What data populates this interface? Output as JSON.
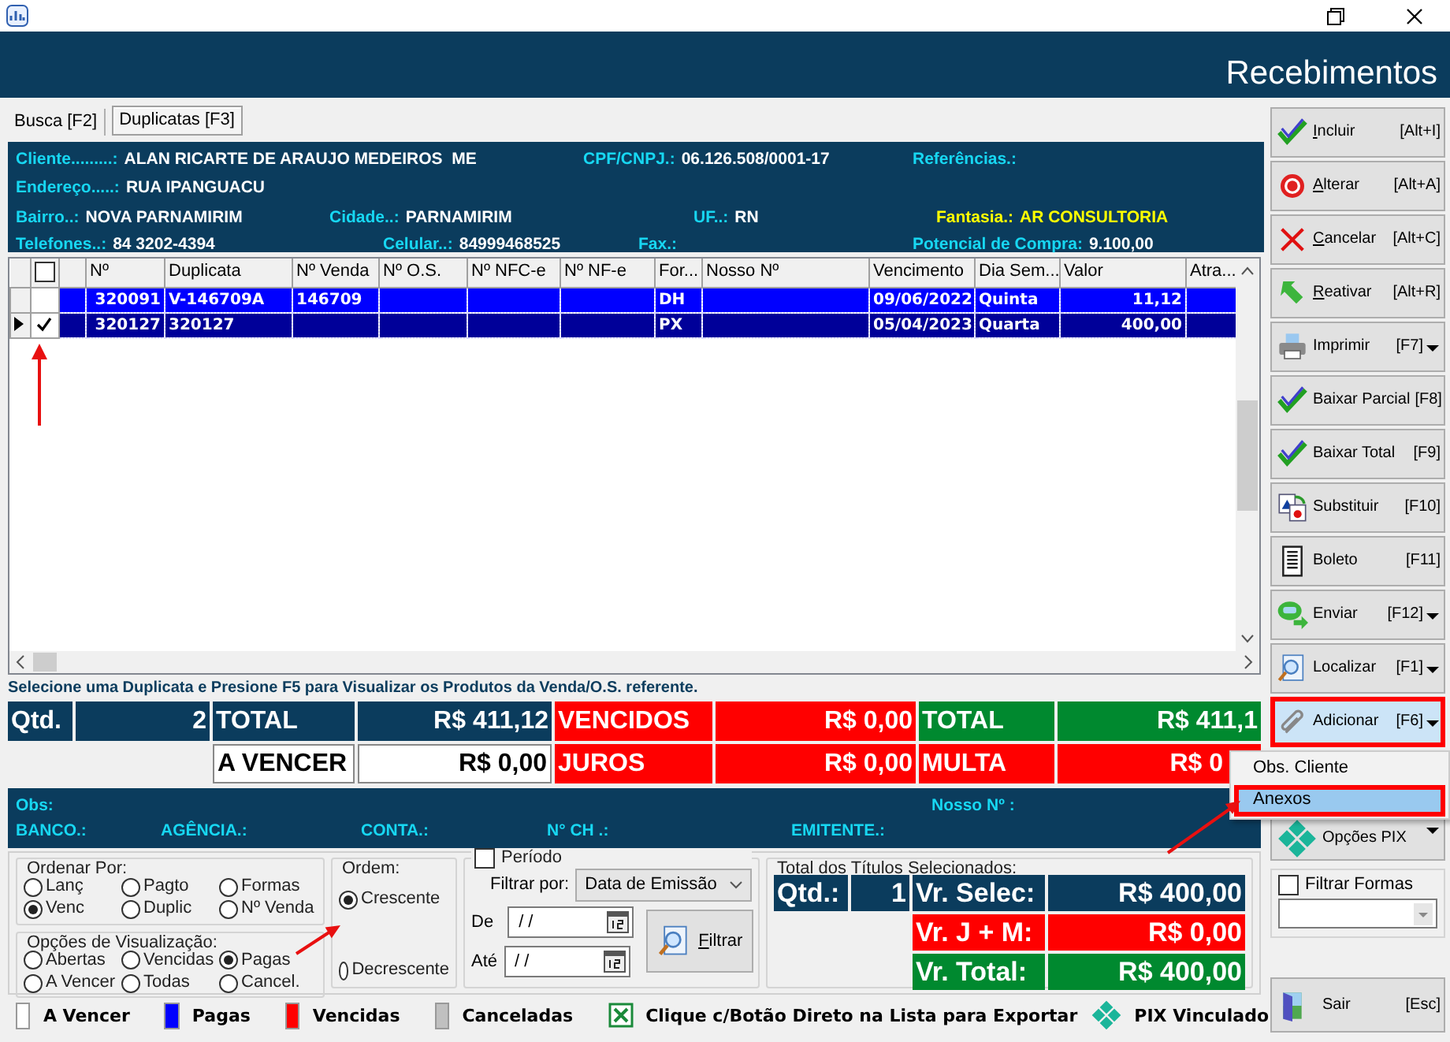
{
  "header": {
    "title": "Recebimentos"
  },
  "tabs": [
    {
      "label": "Busca [F2]",
      "selected": false
    },
    {
      "label": "Duplicatas [F3]",
      "selected": true
    }
  ],
  "client_info": [
    [
      {
        "label": "Cliente.........:",
        "value": "ALAN RICARTE DE ARAUJO MEDEIROS  ME",
        "highlight": false
      },
      {
        "label": "CPF/CNPJ.:",
        "value": "06.126.508/0001-17",
        "highlight": false
      },
      {
        "label": "Referências.:",
        "highlight": false
      }
    ],
    [
      {
        "label": "Endereço.....:",
        "value": "RUA IPANGUACU",
        "highlight": false
      }
    ],
    [
      {
        "label": "Bairro..:",
        "value": "NOVA PARNAMIRIM",
        "highlight": false
      },
      {
        "label": "Cidade..:",
        "value": "PARNAMIRIM",
        "highlight": false
      },
      {
        "label": "UF..:",
        "value": "RN",
        "highlight": false
      },
      {
        "label": "Fantasia.:",
        "value": "AR CONSULTORIA",
        "highlight": true
      }
    ],
    [
      {
        "label": "Telefones..:",
        "value": "84 3202-4394",
        "highlight": false
      },
      {
        "label": "Celular..:",
        "value": "84999468525",
        "highlight": false
      },
      {
        "label": "Fax.:",
        "highlight": false
      },
      {
        "label": "Potencial de Compra:",
        "value": "9.100,00",
        "highlight": false
      }
    ]
  ],
  "grid": {
    "select_all_checked": false,
    "columns": [
      null,
      "Nº",
      "Duplicata",
      "Nº Venda",
      "Nº O.S.",
      "Nº NFC-e",
      "Nº NF-e",
      "For...",
      "Nosso Nº",
      "Vencimento",
      "Dia Sem...",
      "Valor",
      "Atra..."
    ],
    "rows": [
      {
        "current": false,
        "checked": false,
        "selected": false,
        "cells": [
          null,
          "320091",
          "V-146709A",
          "146709",
          null,
          null,
          null,
          "DH",
          null,
          "09/06/2022",
          "Quinta",
          "11,12",
          null
        ]
      },
      {
        "current": true,
        "checked": true,
        "selected": true,
        "cells": [
          null,
          "320127",
          "320127",
          null,
          null,
          null,
          null,
          "PX",
          null,
          "05/04/2023",
          "Quarta",
          "400,00",
          null
        ]
      }
    ]
  },
  "hint": "Selecione uma Duplicata e Presione F5 para Visualizar os Produtos da Venda/O.S. referente.",
  "totals": [
    [
      {
        "text": "Qtd.",
        "color": "#0b3c5d"
      },
      {
        "text": "2",
        "color": "#0b3c5d"
      },
      {
        "text": "TOTAL",
        "color": "#0b3c5d"
      },
      {
        "text": "R$ 411,12",
        "color": "#0b3c5d"
      },
      {
        "text": "VENCIDOS",
        "color": "#ff0000"
      },
      {
        "text": "R$ 0,00",
        "color": "#ff0000"
      },
      {
        "text": "TOTAL",
        "color": "#00892f"
      },
      {
        "text": "R$ 411,1",
        "color": "#00892f"
      }
    ],
    [
      {
        "text": "A VENCER",
        "color": "#ffffff"
      },
      {
        "text": "R$ 0,00",
        "color": "#ffffff"
      },
      {
        "text": "JUROS",
        "color": "#ff0000"
      },
      {
        "text": "R$ 0,00",
        "color": "#ff0000"
      },
      {
        "text": "MULTA",
        "color": "#ff0000"
      },
      {
        "text": "R$ 0",
        "color": "#ff0000"
      }
    ]
  ],
  "obs_panel": [
    [
      "Obs:",
      "Nosso Nº :"
    ],
    [
      "BANCO.:",
      "AGÊNCIA.:",
      "CONTA.:",
      "N° CH .:",
      "EMITENTE.:"
    ]
  ],
  "order_by": {
    "title": "Ordenar Por:",
    "options": [
      {
        "label": "Lanç",
        "selected": false
      },
      {
        "label": "Pagto",
        "selected": false
      },
      {
        "label": "Formas",
        "selected": false
      },
      {
        "label": "Venc",
        "selected": true
      },
      {
        "label": "Duplic",
        "selected": false
      },
      {
        "label": "Nº Venda",
        "selected": false
      }
    ]
  },
  "view_options": {
    "title": "Opções de Visualização:",
    "options": [
      {
        "label": "Abertas",
        "selected": false
      },
      {
        "label": "Vencidas",
        "selected": false
      },
      {
        "label": "Pagas",
        "selected": true
      },
      {
        "label": "A Vencer",
        "selected": false
      },
      {
        "label": "Todas",
        "selected": false
      },
      {
        "label": "Cancel.",
        "selected": false
      }
    ]
  },
  "order": {
    "title": "Ordem:",
    "options": [
      {
        "label": "Crescente",
        "selected": true
      },
      {
        "label": "Decrescente",
        "selected": false
      }
    ]
  },
  "period": {
    "label": "Período",
    "checked": false,
    "filter_label": "Filtrar por:",
    "filter_value": "Data de Emissão",
    "from_label": "De",
    "from_value": "/ /",
    "to_label": "Até",
    "to_value": "/ /",
    "button": "Filtrar",
    "underlined_initial": true
  },
  "selected_totals": {
    "title": "Total dos Títulos Selecionados:",
    "rows": [
      [
        {
          "text": "Qtd.:",
          "color": "#0b3c5d"
        },
        {
          "text": "1",
          "color": "#0b3c5d"
        },
        {
          "text": "Vr. Selec:",
          "color": "#0b3c5d"
        },
        {
          "text": "R$ 400,00",
          "color": "#0b3c5d"
        }
      ],
      [
        {
          "text": "Vr. J + M:",
          "color": "#ff0000"
        },
        {
          "text": "R$ 0,00",
          "color": "#ff0000"
        }
      ],
      [
        {
          "text": "Vr. Total:",
          "color": "#00892f"
        },
        {
          "text": "R$ 400,00",
          "color": "#00892f"
        }
      ]
    ]
  },
  "legend": [
    {
      "label": "A Vencer",
      "color": "#ffffff"
    },
    {
      "label": "Pagas",
      "color": "#0000ff"
    },
    {
      "label": "Vencidas",
      "color": "#ff0000"
    },
    {
      "label": "Canceladas",
      "color": "#c0c0c0"
    }
  ],
  "legend_notes": [
    {
      "kind": "excel",
      "text": "Clique c/Botão Direto na Lista para Exportar"
    },
    {
      "kind": "pix",
      "text": "PIX Vinculado"
    }
  ],
  "actions": [
    {
      "label": "Incluir",
      "shortcut": "[Alt+I]",
      "kind": "check",
      "underlined_initial": true,
      "dropdown": false
    },
    {
      "label": "Alterar",
      "shortcut": "[Alt+A]",
      "kind": "target",
      "underlined_initial": true,
      "dropdown": false
    },
    {
      "label": "Cancelar",
      "shortcut": "[Alt+C]",
      "kind": "cross",
      "underlined_initial": true,
      "dropdown": false
    },
    {
      "label": "Reativar",
      "shortcut": "[Alt+R]",
      "kind": "arrow",
      "underlined_initial": true,
      "dropdown": false
    },
    {
      "label": "Imprimir",
      "shortcut": "[F7]",
      "kind": "printer",
      "underlined_initial": false,
      "dropdown": true
    },
    {
      "label": "Baixar Parcial",
      "shortcut": "[F8]",
      "kind": "check",
      "underlined_initial": false,
      "dropdown": false
    },
    {
      "label": "Baixar Total",
      "shortcut": "[F9]",
      "kind": "check",
      "underlined_initial": false,
      "dropdown": false
    },
    {
      "label": "Substituir",
      "shortcut": "[F10]",
      "kind": "replace",
      "underlined_initial": false,
      "dropdown": false
    },
    {
      "label": "Boleto",
      "shortcut": "[F11]",
      "kind": "document",
      "underlined_initial": false,
      "dropdown": false
    },
    {
      "label": "Enviar",
      "shortcut": "[F12]",
      "kind": "chat",
      "underlined_initial": false,
      "dropdown": true
    },
    {
      "label": "Localizar",
      "shortcut": "[F1]",
      "kind": "search",
      "underlined_initial": false,
      "dropdown": true
    },
    {
      "label": "Adicionar",
      "shortcut": "[F6]",
      "kind": "paperclip",
      "underlined_initial": false,
      "dropdown": true,
      "highlighted": true,
      "expanded": true,
      "menu": [
        {
          "label": "Obs. Cliente",
          "selected": false,
          "highlighted": false
        },
        {
          "label": "Anexos",
          "selected": true,
          "highlighted": true
        }
      ]
    },
    {
      "label": "Opções PIX",
      "kind": "pix",
      "underlined_initial": false,
      "dropdown": true
    }
  ],
  "filter_forms": {
    "label": "Filtrar Formas",
    "checked": false
  },
  "exit": {
    "label": "Sair",
    "shortcut": "[Esc]",
    "kind": "door",
    "underlined_initial": false
  }
}
